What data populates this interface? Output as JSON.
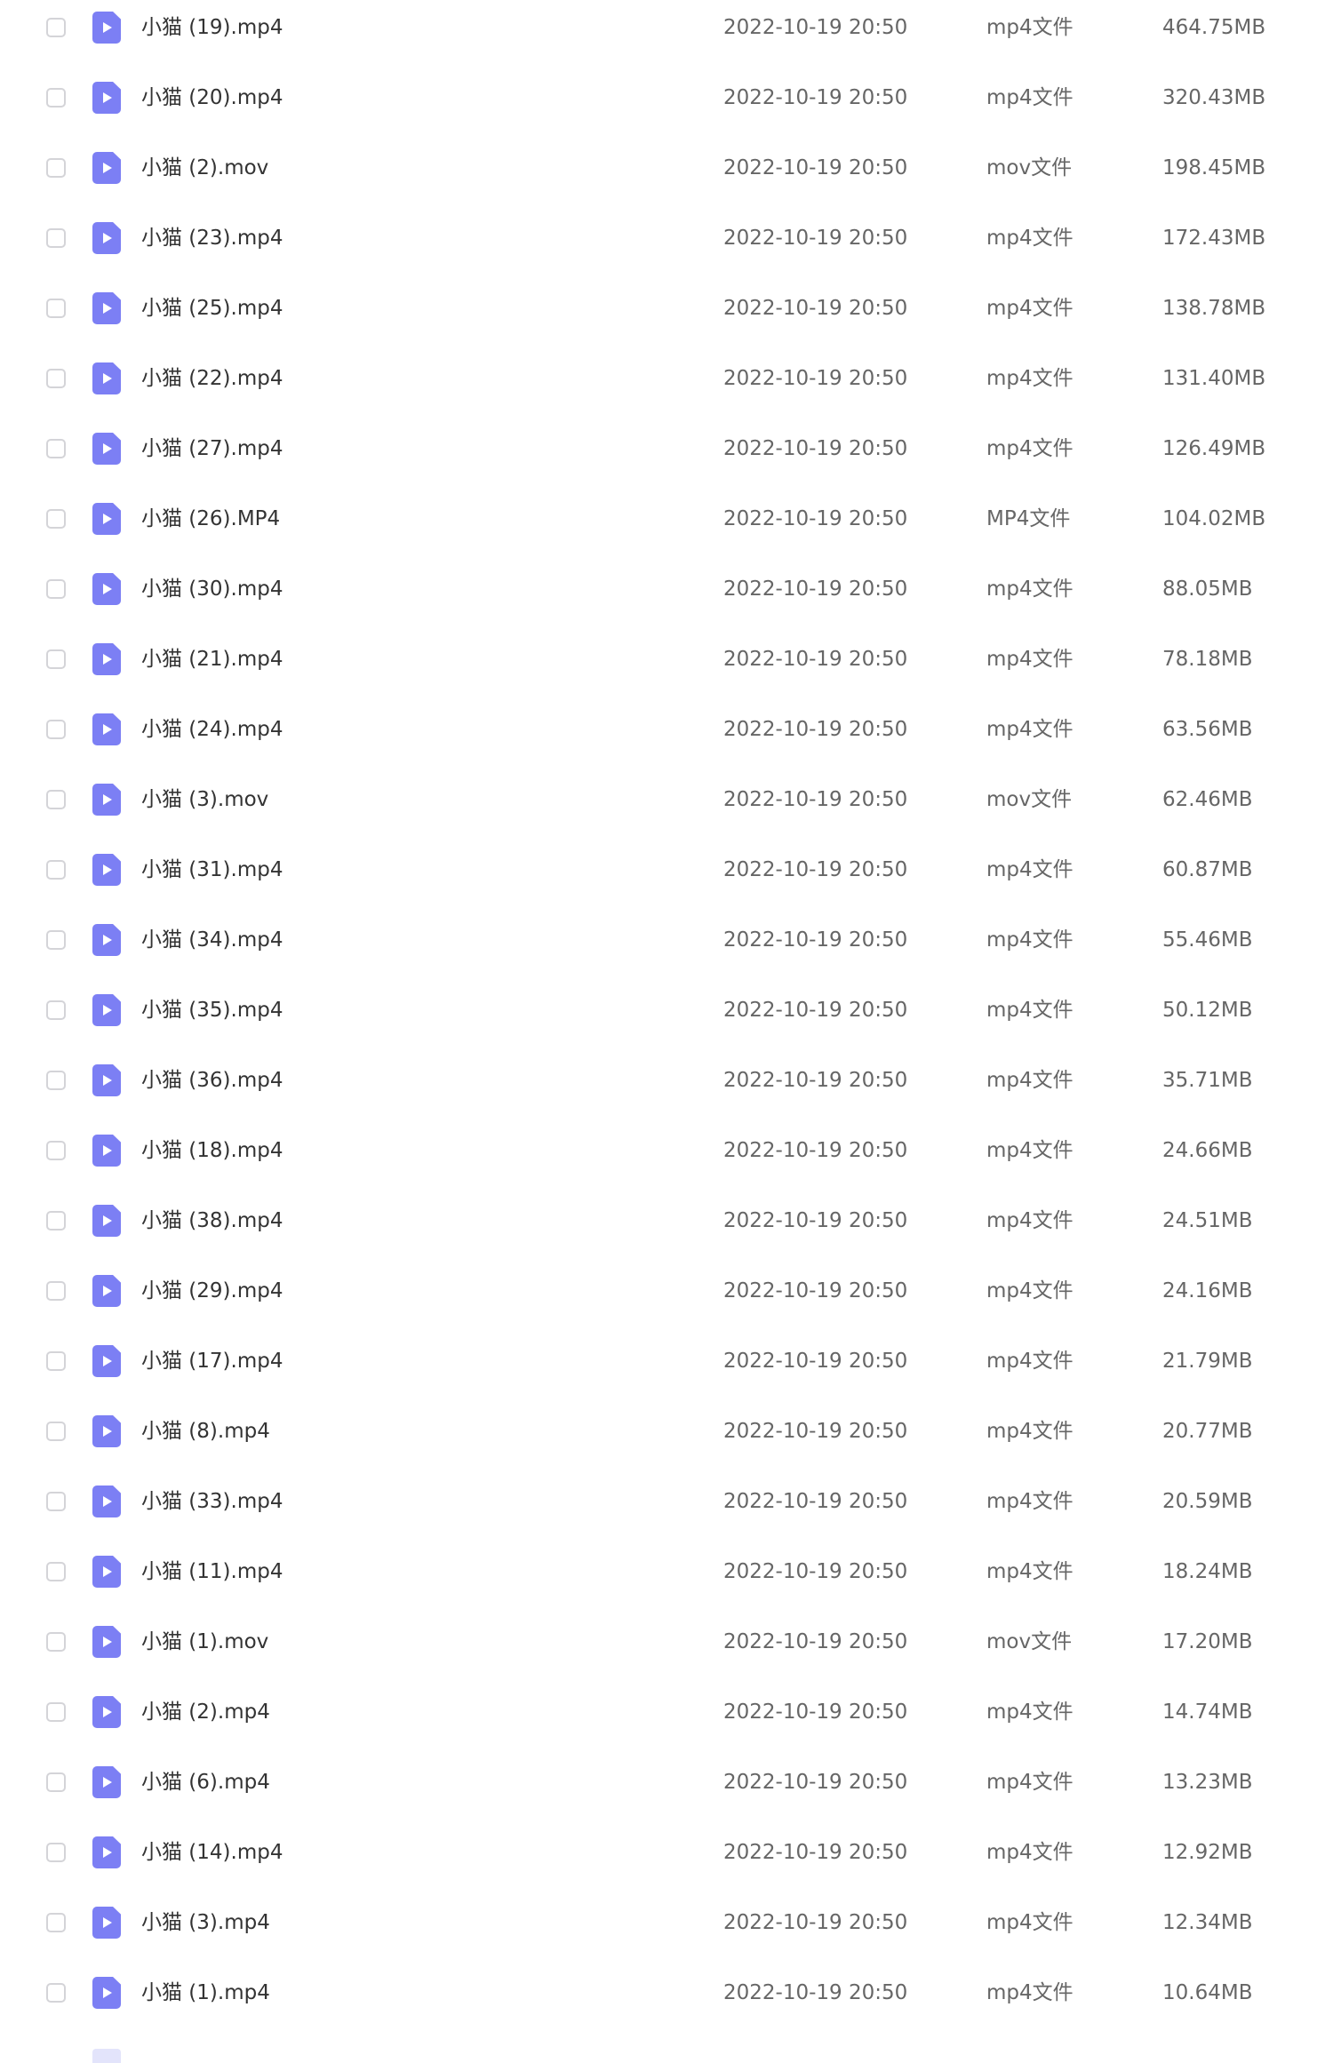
{
  "colors": {
    "icon_accent": "#7c7ff4",
    "text_primary": "#333333",
    "text_secondary": "#666666",
    "checkbox_border": "#d4d4d8"
  },
  "icons": {
    "file_icon": "video-file-icon",
    "row_selector": "checkbox"
  },
  "files": [
    {
      "name": "小猫 (19).mp4",
      "date": "2022-10-19 20:50",
      "type": "mp4文件",
      "size": "464.75MB"
    },
    {
      "name": "小猫 (20).mp4",
      "date": "2022-10-19 20:50",
      "type": "mp4文件",
      "size": "320.43MB"
    },
    {
      "name": "小猫 (2).mov",
      "date": "2022-10-19 20:50",
      "type": "mov文件",
      "size": "198.45MB"
    },
    {
      "name": "小猫 (23).mp4",
      "date": "2022-10-19 20:50",
      "type": "mp4文件",
      "size": "172.43MB"
    },
    {
      "name": "小猫 (25).mp4",
      "date": "2022-10-19 20:50",
      "type": "mp4文件",
      "size": "138.78MB"
    },
    {
      "name": "小猫 (22).mp4",
      "date": "2022-10-19 20:50",
      "type": "mp4文件",
      "size": "131.40MB"
    },
    {
      "name": "小猫 (27).mp4",
      "date": "2022-10-19 20:50",
      "type": "mp4文件",
      "size": "126.49MB"
    },
    {
      "name": "小猫 (26).MP4",
      "date": "2022-10-19 20:50",
      "type": "MP4文件",
      "size": "104.02MB"
    },
    {
      "name": "小猫 (30).mp4",
      "date": "2022-10-19 20:50",
      "type": "mp4文件",
      "size": "88.05MB"
    },
    {
      "name": "小猫 (21).mp4",
      "date": "2022-10-19 20:50",
      "type": "mp4文件",
      "size": "78.18MB"
    },
    {
      "name": "小猫 (24).mp4",
      "date": "2022-10-19 20:50",
      "type": "mp4文件",
      "size": "63.56MB"
    },
    {
      "name": "小猫 (3).mov",
      "date": "2022-10-19 20:50",
      "type": "mov文件",
      "size": "62.46MB"
    },
    {
      "name": "小猫 (31).mp4",
      "date": "2022-10-19 20:50",
      "type": "mp4文件",
      "size": "60.87MB"
    },
    {
      "name": "小猫 (34).mp4",
      "date": "2022-10-19 20:50",
      "type": "mp4文件",
      "size": "55.46MB"
    },
    {
      "name": "小猫 (35).mp4",
      "date": "2022-10-19 20:50",
      "type": "mp4文件",
      "size": "50.12MB"
    },
    {
      "name": "小猫 (36).mp4",
      "date": "2022-10-19 20:50",
      "type": "mp4文件",
      "size": "35.71MB"
    },
    {
      "name": "小猫 (18).mp4",
      "date": "2022-10-19 20:50",
      "type": "mp4文件",
      "size": "24.66MB"
    },
    {
      "name": "小猫 (38).mp4",
      "date": "2022-10-19 20:50",
      "type": "mp4文件",
      "size": "24.51MB"
    },
    {
      "name": "小猫 (29).mp4",
      "date": "2022-10-19 20:50",
      "type": "mp4文件",
      "size": "24.16MB"
    },
    {
      "name": "小猫 (17).mp4",
      "date": "2022-10-19 20:50",
      "type": "mp4文件",
      "size": "21.79MB"
    },
    {
      "name": "小猫 (8).mp4",
      "date": "2022-10-19 20:50",
      "type": "mp4文件",
      "size": "20.77MB"
    },
    {
      "name": "小猫 (33).mp4",
      "date": "2022-10-19 20:50",
      "type": "mp4文件",
      "size": "20.59MB"
    },
    {
      "name": "小猫 (11).mp4",
      "date": "2022-10-19 20:50",
      "type": "mp4文件",
      "size": "18.24MB"
    },
    {
      "name": "小猫 (1).mov",
      "date": "2022-10-19 20:50",
      "type": "mov文件",
      "size": "17.20MB"
    },
    {
      "name": "小猫 (2).mp4",
      "date": "2022-10-19 20:50",
      "type": "mp4文件",
      "size": "14.74MB"
    },
    {
      "name": "小猫 (6).mp4",
      "date": "2022-10-19 20:50",
      "type": "mp4文件",
      "size": "13.23MB"
    },
    {
      "name": "小猫 (14).mp4",
      "date": "2022-10-19 20:50",
      "type": "mp4文件",
      "size": "12.92MB"
    },
    {
      "name": "小猫 (3).mp4",
      "date": "2022-10-19 20:50",
      "type": "mp4文件",
      "size": "12.34MB"
    },
    {
      "name": "小猫 (1).mp4",
      "date": "2022-10-19 20:50",
      "type": "mp4文件",
      "size": "10.64MB"
    }
  ]
}
